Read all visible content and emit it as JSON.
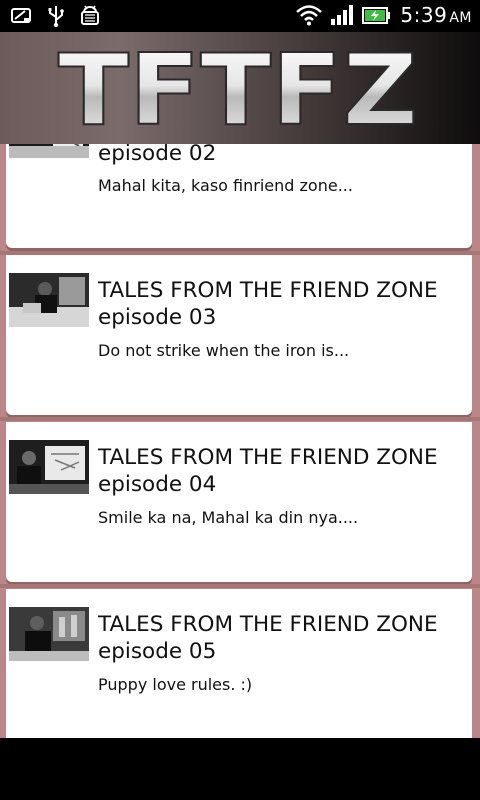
{
  "status_bar": {
    "time": "5:39",
    "ampm": "AM",
    "icons": [
      "usb-debug-icon",
      "usb-icon",
      "android-icon",
      "wifi-icon",
      "signal-icon",
      "battery-charging-icon"
    ]
  },
  "header": {
    "logo_text": "TFTFZ"
  },
  "episodes": [
    {
      "title_line1": "",
      "title_line2": "episode 02",
      "description": "Mahal kita, kaso finriend zone..."
    },
    {
      "title_line1": "TALES FROM THE FRIEND ZONE",
      "title_line2": "episode 03",
      "description": "Do not strike when the iron is..."
    },
    {
      "title_line1": "TALES FROM THE FRIEND ZONE",
      "title_line2": "episode 04",
      "description": "Smile ka na, Mahal ka din nya...."
    },
    {
      "title_line1": "TALES FROM THE FRIEND ZONE",
      "title_line2": "episode 05",
      "description": "Puppy love rules. :)"
    }
  ],
  "colors": {
    "accent": "#b98787",
    "card": "#ffffff",
    "bar": "#000000"
  }
}
